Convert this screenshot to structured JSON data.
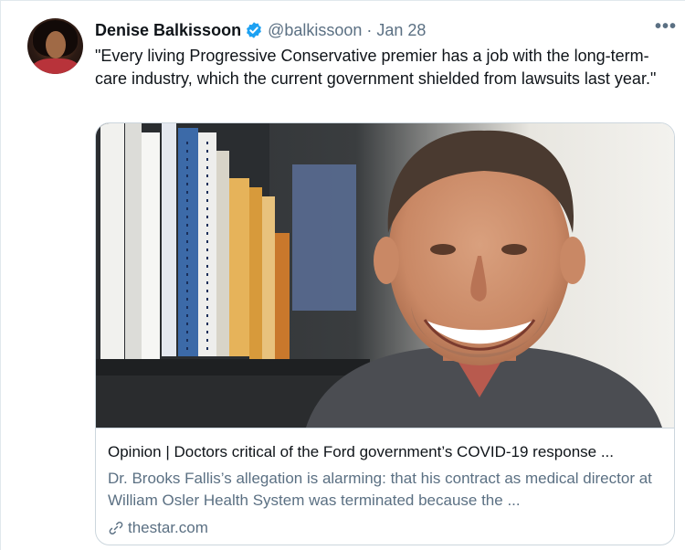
{
  "tweet": {
    "author_name": "Denise Balkissoon",
    "handle": "@balkissoon",
    "separator": "·",
    "date": "Jan 28",
    "more_label": "•••",
    "text": "\"Every living Progressive Conservative premier has a job with the long-term-care industry, which the current government shielded from lawsuits last year.\""
  },
  "card": {
    "title": "Opinion | Doctors critical of the Ford government’s COVID-19 response ...",
    "description": "Dr. Brooks Fallis’s allegation is alarming: that his contract as medical director at William Osler Health System was terminated because the ...",
    "domain": "thestar.com"
  },
  "colors": {
    "accent": "#1da1f2",
    "muted_text": "#5b7083",
    "border": "#ccd6dd"
  },
  "icons": {
    "verified": "verified-badge-icon",
    "more": "more-options-icon",
    "link": "link-icon"
  }
}
